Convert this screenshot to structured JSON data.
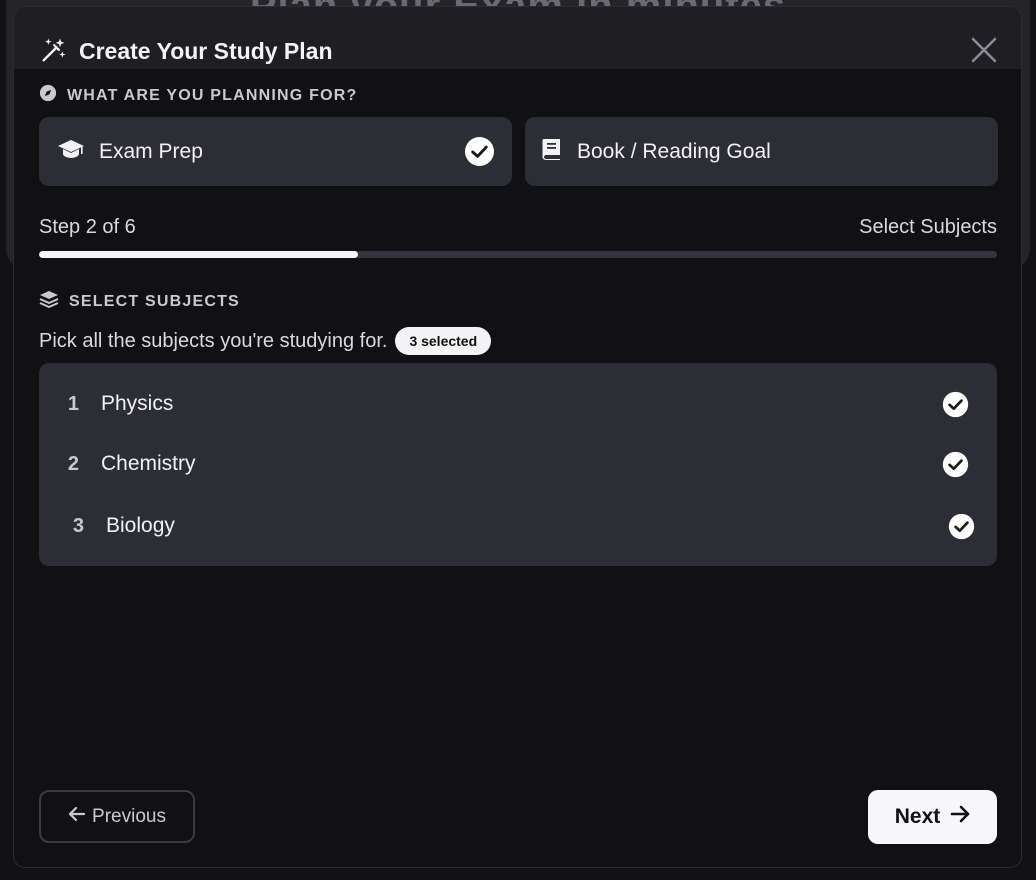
{
  "background": {
    "title": "Plan your Exam in minutes"
  },
  "modal": {
    "title": "Create Your Study Plan",
    "title_icon": "magic-wand-icon",
    "close_icon": "close-icon"
  },
  "planning": {
    "section_label": "WHAT ARE YOU PLANNING FOR?",
    "section_icon": "compass-icon",
    "options": [
      {
        "label": "Exam Prep",
        "icon": "graduation-cap-icon",
        "selected": true
      },
      {
        "label": "Book / Reading Goal",
        "icon": "book-icon",
        "selected": false
      }
    ]
  },
  "progress": {
    "step_text": "Step 2 of 6",
    "step_name": "Select Subjects",
    "current": 2,
    "total": 6,
    "fill_fraction": 0.333
  },
  "subjects": {
    "section_label": "SELECT SUBJECTS",
    "section_icon": "layers-icon",
    "prompt": "Pick all the subjects you're studying for.",
    "badge": "3 selected",
    "items": [
      {
        "num": "1",
        "name": "Physics",
        "checked": true
      },
      {
        "num": "2",
        "name": "Chemistry",
        "checked": true
      },
      {
        "num": "3",
        "name": "Biology",
        "checked": true
      }
    ]
  },
  "footer": {
    "previous_label": "Previous",
    "next_label": "Next"
  },
  "colors": {
    "modal_bg": "#111114",
    "card_bg": "#2c2d35",
    "accent": "#f4f4f6",
    "track": "#34353d"
  }
}
